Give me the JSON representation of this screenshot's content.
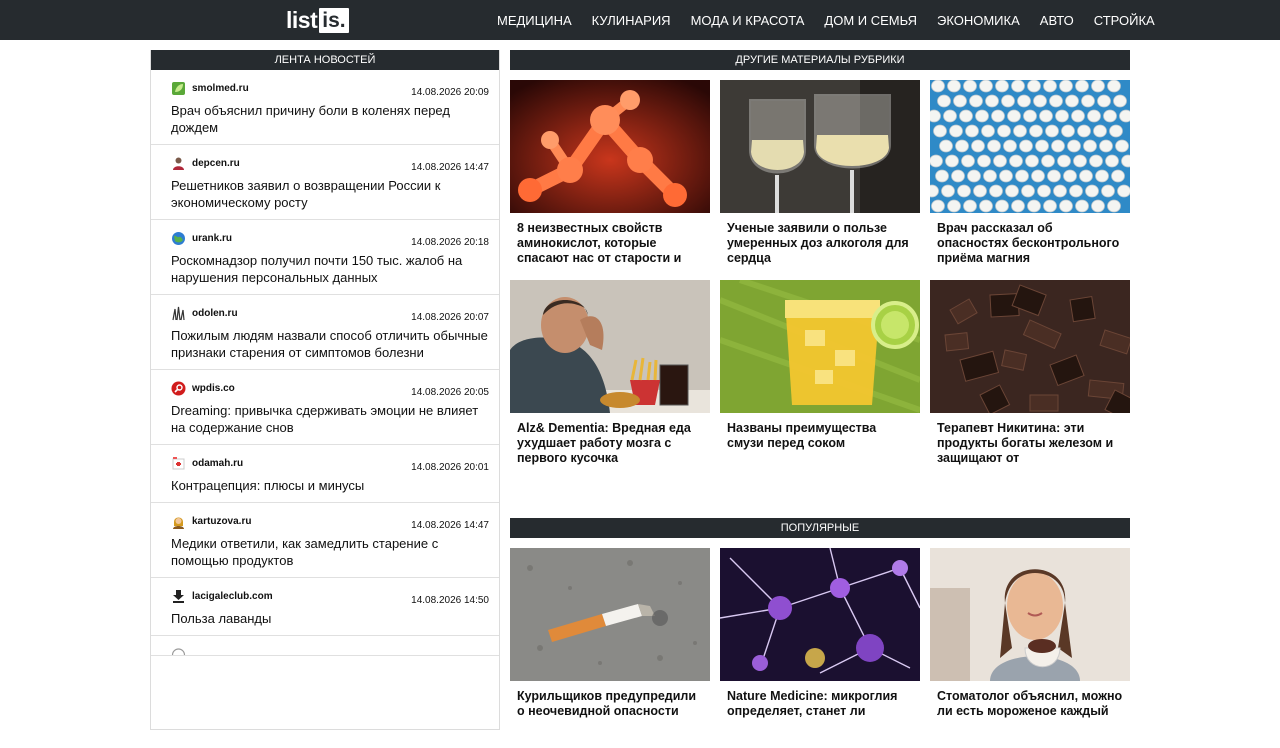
{
  "header": {
    "logo_a": "list",
    "logo_b": "is.",
    "nav": [
      "МЕДИЦИНА",
      "КУЛИНАРИЯ",
      "МОДА И КРАСОТА",
      "ДОМ И СЕМЬЯ",
      "ЭКОНОМИКА",
      "АВТО",
      "СТРОЙКА"
    ]
  },
  "feed": {
    "heading": "ЛЕНТА НОВОСТЕЙ",
    "items": [
      {
        "source": "smolmed.ru",
        "time": "14.08.2026 20:09",
        "title": "Врач объяснил причину боли в коленях перед дождем",
        "icon": "green-leaf-icon"
      },
      {
        "source": "depcen.ru",
        "time": "14.08.2026 14:47",
        "title": "Решетников заявил о возвращении России к экономическому росту",
        "icon": "person-icon"
      },
      {
        "source": "urank.ru",
        "time": "14.08.2026 20:18",
        "title": "Роскомнадзор получил почти 150 тыс. жалоб на нарушения персональных данных",
        "icon": "globe-icon"
      },
      {
        "source": "odolen.ru",
        "time": "14.08.2026 20:07",
        "title": "Пожилым людям назвали способ отличить обычные признаки старения от симптомов болезни",
        "icon": "grass-icon"
      },
      {
        "source": "wpdis.co",
        "time": "14.08.2026 20:05",
        "title": "Dreaming: привычка сдерживать эмоции не влияет на содержание снов",
        "icon": "magnifier-icon"
      },
      {
        "source": "odamah.ru",
        "time": "14.08.2026 20:01",
        "title": "Контрацепция: плюсы и минусы",
        "icon": "medical-icon"
      },
      {
        "source": "kartuzova.ru",
        "time": "14.08.2026 14:47",
        "title": "Медики ответили, как замедлить старение с помощью продуктов",
        "icon": "woman-icon"
      },
      {
        "source": "lacigaleclub.com",
        "time": "14.08.2026 14:50",
        "title": "Польза лаванды",
        "icon": "download-icon"
      }
    ]
  },
  "rubric": {
    "heading": "ДРУГИЕ МАТЕРИАЛЫ РУБРИКИ",
    "cards": [
      {
        "title": "8 неизвестных свойств аминокислот, которые спасают нас от старости и",
        "image": "amino-molecule"
      },
      {
        "title": "Ученые заявили о пользе умеренных доз алкоголя для сердца",
        "image": "wine-glasses"
      },
      {
        "title": "Врач рассказал об опасностях бесконтрольного приёма магния",
        "image": "white-pills"
      },
      {
        "title": "Alz& Dementia: Вредная еда ухудшает работу мозга с первого кусочка",
        "image": "man-fastfood"
      },
      {
        "title": "Названы преимущества смузи перед соком",
        "image": "smoothie-glass"
      },
      {
        "title": "Терапевт Никитина: эти продукты богаты железом и защищают от",
        "image": "dark-chocolate"
      }
    ]
  },
  "popular": {
    "heading": "ПОПУЛЯРНЫЕ",
    "cards": [
      {
        "title": "Курильщиков предупредили о неочевидной опасности",
        "image": "cigarette-butt"
      },
      {
        "title": "Nature Medicine: микроглия определяет, станет ли",
        "image": "neurons"
      },
      {
        "title": "Стоматолог объяснил, можно ли есть мороженое каждый",
        "image": "woman-icecream"
      }
    ]
  }
}
